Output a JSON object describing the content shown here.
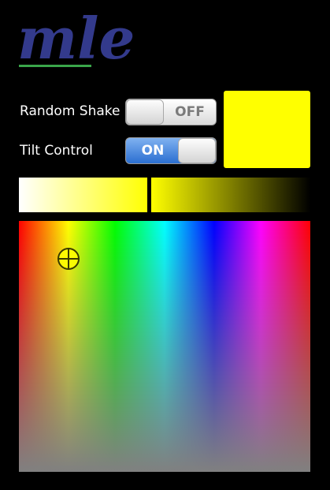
{
  "app": {
    "logo_text": "mle"
  },
  "controls": [
    {
      "label": "Random Shake",
      "state": "OFF"
    },
    {
      "label": "Tilt Control",
      "state": "ON"
    }
  ],
  "selected_color": "#ffff00",
  "colors": {
    "logo": "#333a8c",
    "logo_underline": "#3aa64a",
    "toggle_on": "#2b6fd1"
  }
}
